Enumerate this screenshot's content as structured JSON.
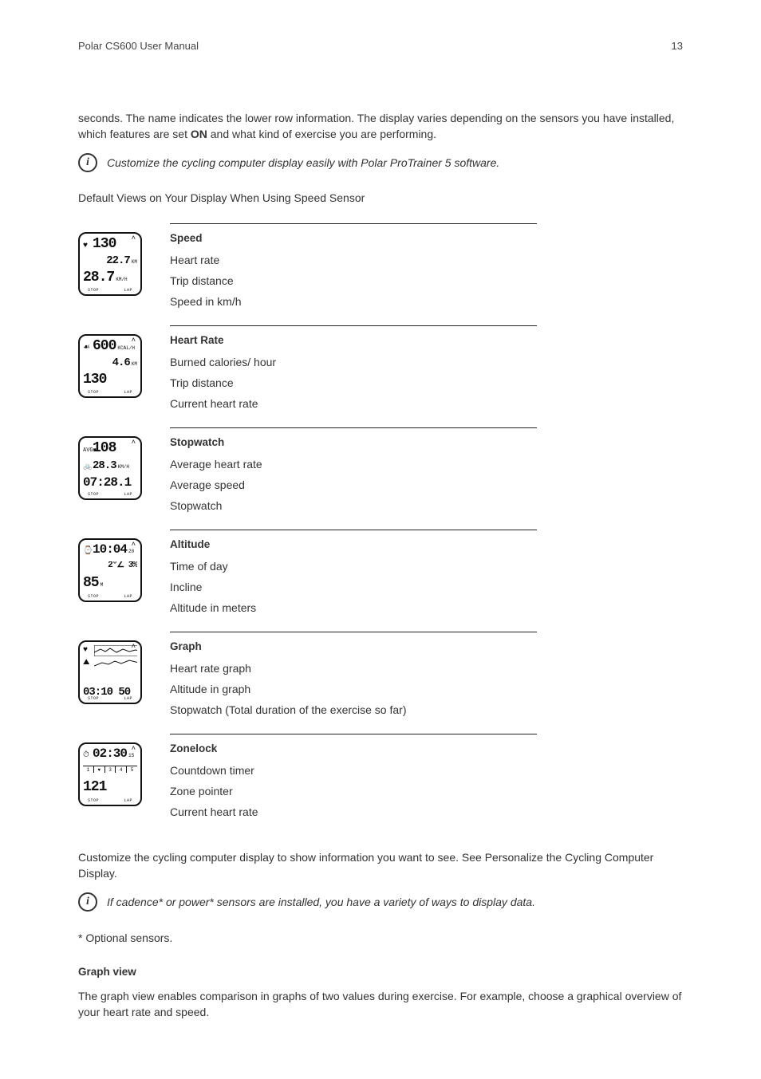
{
  "header": {
    "title": "Polar CS600 User Manual",
    "page_number": "13"
  },
  "intro": {
    "p1_a": "seconds. The name indicates the lower row information. The display varies depending on the sensors you have installed, which features are set ",
    "p1_on": "ON",
    "p1_b": " and what kind of exercise you are performing.",
    "info1": "Customize the cycling computer display easily with Polar ProTrainer 5 software.",
    "section_title": "Default Views on Your Display When Using Speed Sensor"
  },
  "views": [
    {
      "title": "Speed",
      "lines": [
        "Heart rate",
        "Trip distance",
        "Speed in km/h"
      ],
      "thumb": {
        "r1_icon": "♥",
        "r1": "130",
        "r2": "22.7",
        "r2_unit": "KM",
        "r3": "28.7",
        "r3_unit": "KM/H"
      }
    },
    {
      "title": "Heart Rate",
      "lines": [
        "Burned calories/ hour",
        "Trip distance",
        "Current heart rate"
      ],
      "thumb": {
        "r1_icon": "☙",
        "r1": "600",
        "r1_unit": "KCAL/H",
        "r2": "4.6",
        "r2_unit": "KM",
        "r3": "130"
      }
    },
    {
      "title": "Stopwatch",
      "lines": [
        "Average heart rate",
        "Average speed",
        "Stopwatch"
      ],
      "thumb": {
        "r1_icon": "AVG♥",
        "r1": "108",
        "r2_icon": "🚲",
        "r2": "28.3",
        "r2_unit": "KM/H",
        "r3": "07:28.1"
      }
    },
    {
      "title": "Altitude",
      "lines": [
        "Time of day",
        "Incline",
        "Altitude in meters"
      ],
      "thumb": {
        "r1_icon": "⌚",
        "r1": "10:04",
        "r1_sub": "20",
        "r2": "2°∠  3%",
        "r3": "85",
        "r3_unit": "M"
      }
    },
    {
      "title": "Graph",
      "lines": [
        "Heart rate graph",
        "Altitude in graph",
        "Stopwatch (Total duration of the exercise so far)"
      ],
      "thumb": {
        "r3": "03:10 50"
      }
    },
    {
      "title": "Zonelock",
      "lines": [
        "Countdown timer",
        "Zone pointer",
        "Current heart rate"
      ],
      "thumb": {
        "r1_icon": "⏱",
        "r1": "02:30",
        "r1_sub": "15",
        "zones": [
          "1",
          "♥",
          "3",
          "4",
          "5"
        ],
        "r3": "121"
      }
    }
  ],
  "footer": {
    "p1": "Customize the cycling computer display to show information you want to see. See Personalize the Cycling Computer Display.",
    "info2": "If cadence* or power* sensors are installed, you have a variety of ways to display data.",
    "p2": "* Optional sensors.",
    "h1": "Graph view",
    "p3": "The graph view enables comparison in graphs of two values during exercise. For example, choose a graphical overview of your heart rate and speed."
  },
  "labels": {
    "stop": "STOP",
    "lap": "LAP",
    "info_glyph": "i"
  }
}
